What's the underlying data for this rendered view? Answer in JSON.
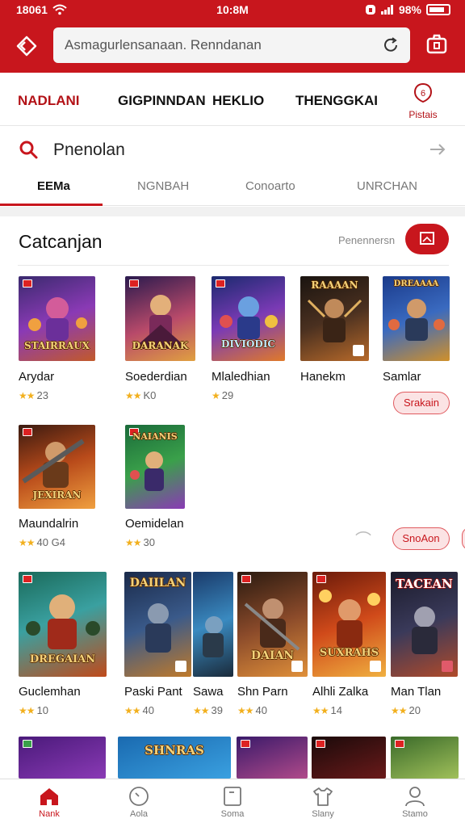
{
  "status_bar": {
    "carrier": "18061",
    "time": "10:8M",
    "battery_label": "98%"
  },
  "address_bar": {
    "url_text": "Asmagurlensanaan. Renndanan"
  },
  "nav": {
    "items": [
      "NADLANI",
      "GIGPINNDAN",
      "HEKLIO",
      "THENGGKAI"
    ],
    "profile_label": "Pistais"
  },
  "search": {
    "text": "Pnenolan"
  },
  "tabs": [
    "EEMa",
    "NGNBAH",
    "Conoarto",
    "UNRCHAN"
  ],
  "section": {
    "title": "Catcanjan",
    "sub_label": "Penennersn"
  },
  "games_row1": [
    {
      "name": "Arydar",
      "rating": "23",
      "logo": "STAIRRAUX"
    },
    {
      "name": "Soederdian",
      "rating": "K0",
      "logo": "DARANAK"
    },
    {
      "name": "Mlaledhian",
      "rating": "29",
      "logo": "DIVIODIC"
    },
    {
      "name": "Hanekm",
      "rating": "",
      "logo": "RAAAAN"
    },
    {
      "name": "Samlar",
      "rating": "",
      "logo": "DREAAAA"
    }
  ],
  "games_row2": [
    {
      "name": "Maundalrin",
      "rating": "40 G4",
      "logo": "JEXIRAN"
    },
    {
      "name": "Oemidelan",
      "rating": "30",
      "logo": "NAIANIS"
    }
  ],
  "pills": {
    "first": "Srakain",
    "second": "SnoAon"
  },
  "games_row3": [
    {
      "name": "Guclemhan",
      "rating": "10",
      "logo": "DREGAIAN"
    },
    {
      "name": "Paski Pant",
      "rating": "40",
      "logo": "DAIILAN"
    },
    {
      "name": "Sawa",
      "rating": "39",
      "logo": ""
    },
    {
      "name": "Shn Parn",
      "rating": "40",
      "logo": "DAIAN"
    },
    {
      "name": "Alhli Zalka",
      "rating": "14",
      "logo": "SUXRAHS"
    },
    {
      "name": "Man Tlan",
      "rating": "20",
      "logo": "TACEAN"
    }
  ],
  "games_row4_logo": "SHNRAS",
  "bottom_nav": [
    "Nank",
    "Aola",
    "Soma",
    "Slany",
    "Stamo"
  ],
  "colors": {
    "brand_red": "#c8161d",
    "star": "#f2b01e"
  },
  "icons": {
    "home": "home-diamond-icon",
    "reload": "reload-icon",
    "camera": "camera-icon",
    "search": "search-icon",
    "arrow": "arrow-right-icon",
    "profile": "profile-badge-icon"
  }
}
